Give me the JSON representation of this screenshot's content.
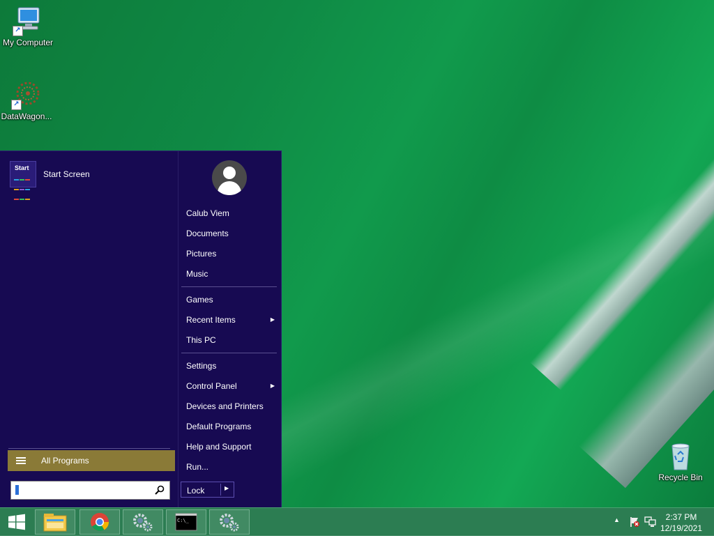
{
  "desktop": {
    "icons": [
      {
        "label": "My Computer"
      },
      {
        "label": "DataWagon..."
      },
      {
        "label": "Recycle Bin"
      }
    ]
  },
  "start_menu": {
    "pinned": {
      "tile_text": "Start",
      "label": "Start Screen"
    },
    "all_programs_label": "All Programs",
    "search": {
      "value": "",
      "placeholder": ""
    },
    "right_items": [
      {
        "label": "Calub Viem"
      },
      {
        "label": "Documents"
      },
      {
        "label": "Pictures"
      },
      {
        "label": "Music"
      },
      {
        "label": "Games"
      },
      {
        "label": "Recent Items",
        "submenu": true
      },
      {
        "label": "This PC"
      },
      {
        "label": "Settings"
      },
      {
        "label": "Control Panel",
        "submenu": true
      },
      {
        "label": "Devices and Printers"
      },
      {
        "label": "Default Programs"
      },
      {
        "label": "Help and Support"
      },
      {
        "label": "Run..."
      }
    ],
    "lock_label": "Lock"
  },
  "taskbar": {
    "buttons": [
      {
        "icon": "file-explorer-icon"
      },
      {
        "icon": "chrome-icon"
      },
      {
        "icon": "settings-gears-icon"
      },
      {
        "icon": "command-prompt-icon",
        "text": "C:\\_"
      },
      {
        "icon": "settings-gears-icon"
      }
    ],
    "clock": {
      "time": "2:37 PM",
      "date": "12/19/2021"
    }
  },
  "colors": {
    "menu_bg": "#170a52",
    "all_programs_bg": "#8a7a37",
    "taskbar_bg": "#2c7d52"
  }
}
